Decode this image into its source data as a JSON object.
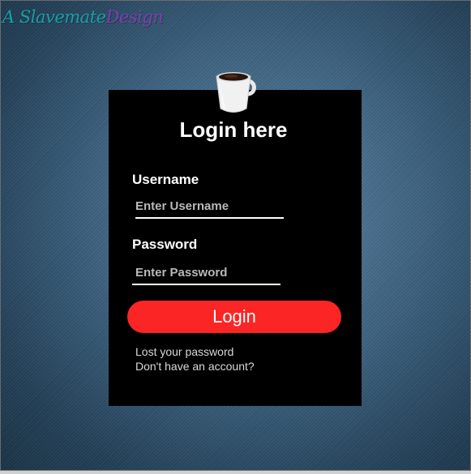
{
  "logo": {
    "part1": "A Slavemate",
    "part2": "Design"
  },
  "form": {
    "title": "Login here",
    "username_label": "Username",
    "username_placeholder": "Enter Username",
    "username_value": "",
    "password_label": "Password",
    "password_placeholder": "Enter Password",
    "password_value": "",
    "submit_label": "Login",
    "lost_password_link": "Lost your password",
    "signup_link": "Don't have an account?"
  },
  "colors": {
    "button": "#fb2525",
    "card": "#000000",
    "background": "#3e6381"
  },
  "icons": {
    "cup": "coffee-cup-icon"
  }
}
